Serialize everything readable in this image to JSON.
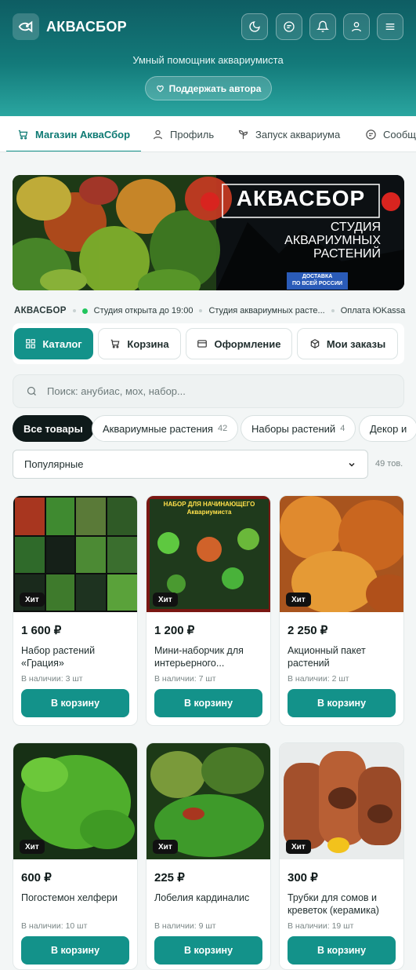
{
  "header": {
    "brand": "АКВАСБОР",
    "subtitle": "Умный помощник аквариумиста",
    "support_label": "Поддержать автора"
  },
  "tabs": [
    {
      "label": "Магазин АкваСбор",
      "icon": "cart-icon"
    },
    {
      "label": "Профиль",
      "icon": "user-icon"
    },
    {
      "label": "Запуск аквариума",
      "icon": "sprout-icon"
    },
    {
      "label": "Сообщ",
      "icon": "chat-icon"
    }
  ],
  "banner": {
    "title": "АКВАСБОР",
    "line1": "СТУДИЯ",
    "line2": "АКВАРИУМНЫХ",
    "line3": "РАСТЕНИЙ",
    "delivery1": "ДОСТАВКА",
    "delivery2": "ПО ВСЕЙ РОССИИ"
  },
  "info": {
    "brand": "АКВАСБОР",
    "open": "Студия открыта до 19:00",
    "studio": "Студия аквариумных расте...",
    "payment": "Оплата ЮKassa"
  },
  "actions": {
    "catalog": "Каталог",
    "cart": "Корзина",
    "checkout": "Оформление",
    "orders": "Мои заказы"
  },
  "search": {
    "placeholder": "Поиск: анубиас, мох, набор..."
  },
  "chips": [
    {
      "label": "Все товары",
      "count": ""
    },
    {
      "label": "Аквариумные растения",
      "count": "42"
    },
    {
      "label": "Наборы растений",
      "count": "4"
    },
    {
      "label": "Декор и",
      "count": ""
    }
  ],
  "sort": {
    "selected": "Популярные",
    "total": "49 тов."
  },
  "products": [
    {
      "price": "1 600 ₽",
      "name": "Набор растений «Грация»",
      "stock": "В наличии: 3 шт",
      "badge": "Хит",
      "button": "В корзину"
    },
    {
      "price": "1 200 ₽",
      "name": "Мини-наборчик для интерьерного...",
      "stock": "В наличии: 7 шт",
      "badge": "Хит",
      "button": "В корзину"
    },
    {
      "price": "2 250 ₽",
      "name": "Акционный пакет растений",
      "stock": "В наличии: 2 шт",
      "badge": "Хит",
      "button": "В корзину"
    },
    {
      "price": "600 ₽",
      "name": "Погостемон хелфери",
      "stock": "В наличии: 10 шт",
      "badge": "Хит",
      "button": "В корзину"
    },
    {
      "price": "225 ₽",
      "name": "Лобелия кардиналис",
      "stock": "В наличии: 9 шт",
      "badge": "Хит",
      "button": "В корзину"
    },
    {
      "price": "300 ₽",
      "name": "Трубки для сомов и креветок (керамика)",
      "stock": "В наличии: 19 шт",
      "badge": "Хит",
      "button": "В корзину"
    }
  ],
  "promo_image": {
    "title": "НАБОР ДЛЯ НАЧИНАЮЩЕГО",
    "subtitle": "Аквариумиста"
  },
  "colors": {
    "accent": "#13928a",
    "header_dark": "#0e5d63"
  }
}
